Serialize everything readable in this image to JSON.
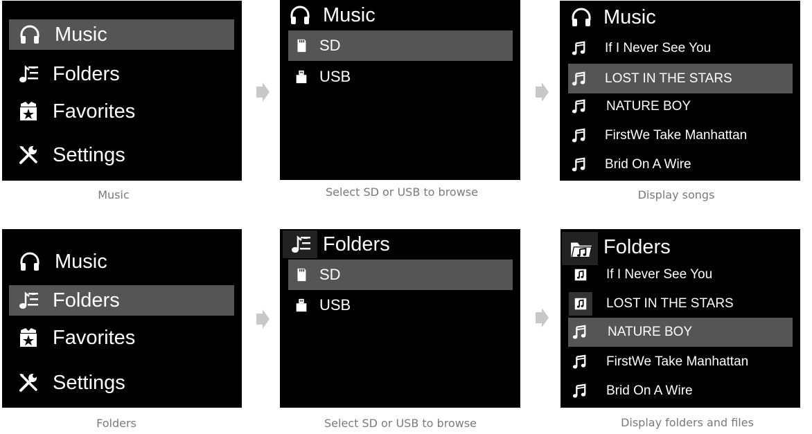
{
  "arrow_icon": "arrow-right-icon",
  "panels": {
    "music_menu": {
      "items": [
        {
          "label": "Music",
          "icon": "headphones-icon"
        },
        {
          "label": "Folders",
          "icon": "folder-music-icon"
        },
        {
          "label": "Favorites",
          "icon": "favorites-box-icon"
        },
        {
          "label": "Settings",
          "icon": "tools-icon"
        }
      ],
      "selected": "Music"
    },
    "music_source": {
      "title": "Music",
      "items": [
        {
          "label": "SD",
          "icon": "sd-card-icon"
        },
        {
          "label": "USB",
          "icon": "usb-icon"
        }
      ],
      "selected": "SD"
    },
    "music_songs": {
      "title": "Music",
      "items": [
        {
          "label": "If I Never See You"
        },
        {
          "label": "LOST IN THE STARS"
        },
        {
          "label": "NATURE BOY"
        },
        {
          "label": "FirstWe Take Manhattan"
        },
        {
          "label": "Brid On  A Wire"
        }
      ],
      "selected": "LOST IN THE STARS"
    },
    "folders_menu": {
      "items": [
        {
          "label": "Music"
        },
        {
          "label": "Folders"
        },
        {
          "label": "Favorites"
        },
        {
          "label": "Settings"
        }
      ],
      "selected": "Folders"
    },
    "folders_source": {
      "title": "Folders",
      "items": [
        {
          "label": "SD"
        },
        {
          "label": "USB"
        }
      ],
      "selected": "SD"
    },
    "folders_files": {
      "title": "Folders",
      "items": [
        {
          "label": "If I Never See You",
          "icon": "music-folder-icon"
        },
        {
          "label": "LOST IN THE STARS",
          "icon": "music-folder-icon"
        },
        {
          "label": "NATURE BOY",
          "icon": "music-note-icon"
        },
        {
          "label": "FirstWe Take Manhattan",
          "icon": "music-note-icon"
        },
        {
          "label": "Brid On  A Wire",
          "icon": "music-note-icon"
        }
      ],
      "selected": "NATURE BOY"
    }
  },
  "captions": {
    "c1": "Music",
    "c2": "Select SD or USB to browse",
    "c3": "Display songs",
    "c4": "Folders",
    "c5": "Select SD or USB to browse",
    "c6": "Display folders and files"
  }
}
